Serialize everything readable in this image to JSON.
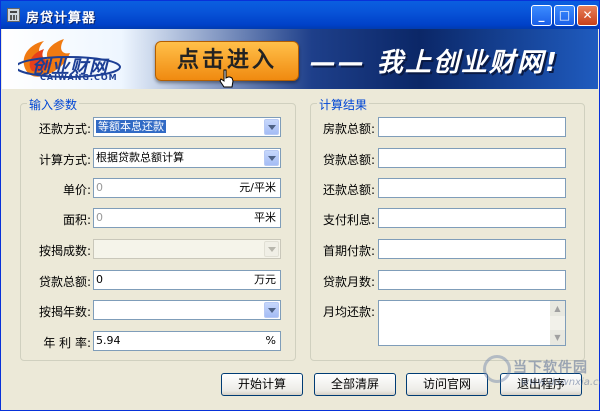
{
  "window": {
    "title": "房贷计算器",
    "controls": {
      "minimize": "_",
      "maximize": "□",
      "close": "✕"
    }
  },
  "banner": {
    "logo_text": "创业财网",
    "logo_sub": "CAIWANG.COM",
    "enter_button": "点击进入",
    "slogan": "——  我上创业财网!"
  },
  "input_group": {
    "title": "输入参数",
    "repay_method": {
      "label": "还款方式:",
      "value": "等额本息还款"
    },
    "calc_method": {
      "label": "计算方式:",
      "value": "根据贷款总额计算"
    },
    "unit_price": {
      "label": "单价:",
      "value": "0",
      "unit": "元/平米"
    },
    "area": {
      "label": "面积:",
      "value": "0",
      "unit": "平米"
    },
    "mortgage_ratio": {
      "label": "按揭成数:",
      "value": ""
    },
    "loan_total": {
      "label": "贷款总额:",
      "value": "0",
      "unit": "万元"
    },
    "mortgage_years": {
      "label": "按揭年数:",
      "value": ""
    },
    "interest_rate": {
      "label": "年 利 率:",
      "value": "5.94",
      "unit": "%"
    }
  },
  "result_group": {
    "title": "计算结果",
    "house_total": {
      "label": "房款总额:",
      "value": ""
    },
    "loan_total": {
      "label": "贷款总额:",
      "value": ""
    },
    "repay_total": {
      "label": "还款总额:",
      "value": ""
    },
    "interest_paid": {
      "label": "支付利息:",
      "value": ""
    },
    "down_payment": {
      "label": "首期付款:",
      "value": ""
    },
    "loan_months": {
      "label": "贷款月数:",
      "value": ""
    },
    "monthly_payment": {
      "label": "月均还款:",
      "value": ""
    }
  },
  "buttons": {
    "calculate": "开始计算",
    "clear_all": "全部清屏",
    "visit_site": "访问官网",
    "exit": "退出程序"
  },
  "watermark": {
    "text": "当下软件园",
    "sub": "www.downxia.com"
  },
  "colors": {
    "titlebar": "#0054e3",
    "group_title": "#0046d5",
    "window_bg": "#ece9d8",
    "selection": "#316ac5"
  }
}
